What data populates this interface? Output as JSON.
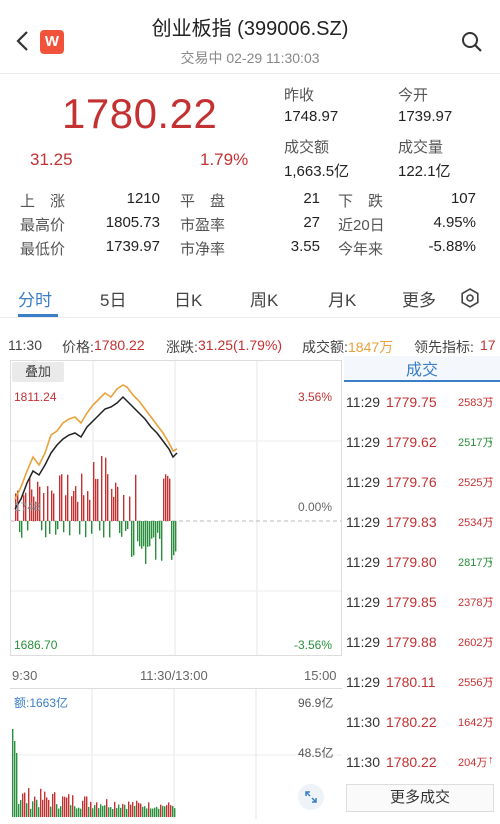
{
  "header": {
    "title": "创业板指 (399006.SZ)",
    "subtitle": "交易中 02-29 11:30:03",
    "logo_text": "W",
    "accent": "#f0533a"
  },
  "quote": {
    "price": "1780.22",
    "change": "31.25",
    "change_pct": "1.79%",
    "prev_close_label": "昨收",
    "prev_close": "1748.97",
    "open_label": "今开",
    "open": "1739.97",
    "amount_label": "成交额",
    "amount": "1,663.5亿",
    "volume_label": "成交量",
    "volume": "122.1亿"
  },
  "grid": {
    "up_label": "上　涨",
    "up": "1210",
    "flat_label": "平　盘",
    "flat": "21",
    "down_label": "下　跌",
    "down": "107",
    "high_label": "最高价",
    "high": "1805.73",
    "pe_label": "市盈率",
    "pe": "27",
    "d20_label": "近20日",
    "d20": "4.95%",
    "low_label": "最低价",
    "low": "1739.97",
    "pb_label": "市净率",
    "pb": "3.55",
    "ytd_label": "今年来",
    "ytd": "-5.88%"
  },
  "tabs": [
    "分时",
    "5日",
    "日K",
    "周K",
    "月K",
    "更多"
  ],
  "infobar": {
    "time": "11:30",
    "price_label": "价格:",
    "price": "1780.22",
    "chg_label": "涨跌:",
    "chg": "31.25(1.79%)",
    "amt_label": "成交额:",
    "amt": "1847万",
    "lead_label": "领先指标:",
    "lead": "17"
  },
  "chart": {
    "overlay_label": "叠加",
    "y_high": "1811.24",
    "y_mid": "1748",
    "y_low": "1686.70",
    "pct_high": "3.56%",
    "pct_mid": "0.00%",
    "pct_low": "-3.56%",
    "t_start": "9:30",
    "t_mid": "11:30/13:00",
    "t_end": "15:00",
    "vol_label": "额:1663亿",
    "vol_high": "96.9亿",
    "vol_mid": "48.5亿"
  },
  "trades": {
    "header": "成交",
    "rows": [
      {
        "time": "11:29",
        "price": "1779.75",
        "vol": "2583万",
        "dir": "up"
      },
      {
        "time": "11:29",
        "price": "1779.62",
        "vol": "2517万",
        "dir": "down"
      },
      {
        "time": "11:29",
        "price": "1779.76",
        "vol": "2525万",
        "dir": "up"
      },
      {
        "time": "11:29",
        "price": "1779.83",
        "vol": "2534万",
        "dir": "up"
      },
      {
        "time": "11:29",
        "price": "1779.80",
        "vol": "2817万",
        "dir": "down"
      },
      {
        "time": "11:29",
        "price": "1779.85",
        "vol": "2378万",
        "dir": "up"
      },
      {
        "time": "11:29",
        "price": "1779.88",
        "vol": "2602万",
        "dir": "up"
      },
      {
        "time": "11:29",
        "price": "1780.11",
        "vol": "2556万",
        "dir": "up"
      },
      {
        "time": "11:30",
        "price": "1780.22",
        "vol": "1642万",
        "dir": "up"
      },
      {
        "time": "11:30",
        "price": "1780.22",
        "vol": "204万",
        "dir": "up"
      }
    ],
    "more_label": "更多成交"
  },
  "colors": {
    "up": "#c43132",
    "down": "#2a8f3c",
    "accent": "#3a7ec7",
    "avg_line": "#e9a23b"
  }
}
